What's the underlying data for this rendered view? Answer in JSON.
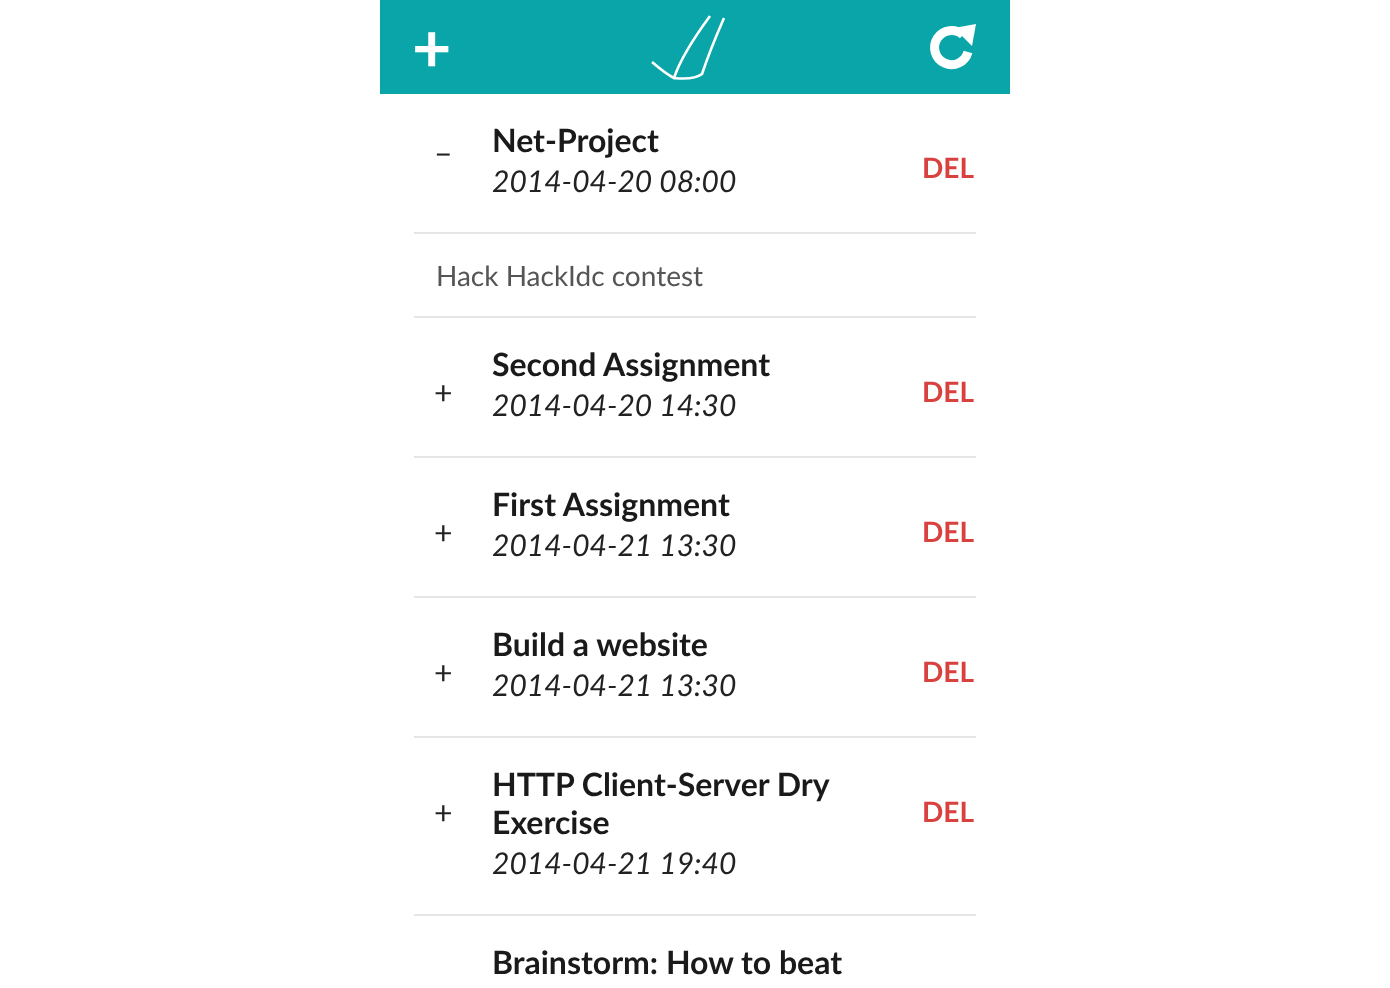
{
  "header": {
    "add": "+"
  },
  "tasks": [
    {
      "toggle": "–",
      "title": "Net-Project",
      "date": "2014-04-20 08:00",
      "delete": "DEL",
      "description": "Hack HackIdc contest"
    },
    {
      "toggle": "+",
      "title": "Second Assignment",
      "date": "2014-04-20 14:30",
      "delete": "DEL"
    },
    {
      "toggle": "+",
      "title": "First Assignment",
      "date": "2014-04-21 13:30",
      "delete": "DEL"
    },
    {
      "toggle": "+",
      "title": "Build a website",
      "date": "2014-04-21 13:30",
      "delete": "DEL"
    },
    {
      "toggle": "+",
      "title": "HTTP Client-Server Dry Exercise",
      "date": "2014-04-21 19:40",
      "delete": "DEL"
    },
    {
      "title": "Brainstorm: How to beat"
    }
  ]
}
